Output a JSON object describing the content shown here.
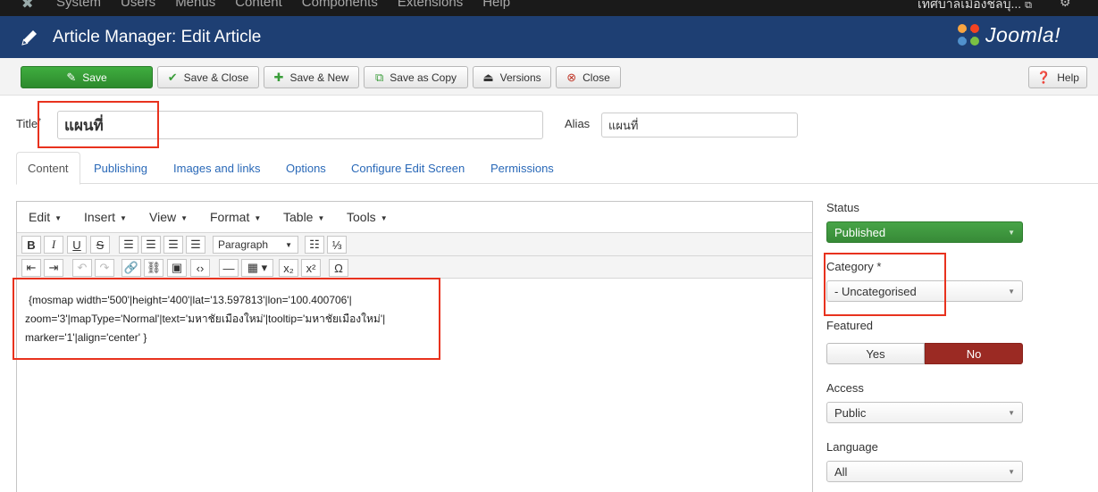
{
  "topnav": {
    "menu": [
      "System",
      "Users",
      "Menus",
      "Content",
      "Components",
      "Extensions",
      "Help"
    ],
    "site_name": "เทศบาลเมืองชลบุ..."
  },
  "header": {
    "title": "Article Manager: Edit Article",
    "logo_text": "Joomla!"
  },
  "toolbar": {
    "save": "Save",
    "save_close": "Save & Close",
    "save_new": "Save & New",
    "save_copy": "Save as Copy",
    "versions": "Versions",
    "close": "Close",
    "help": "Help"
  },
  "form": {
    "title_label": "Title",
    "required_mark": "*",
    "title_value": "แผนที่",
    "alias_label": "Alias",
    "alias_value": "แผนที่"
  },
  "tabs": [
    "Content",
    "Publishing",
    "Images and links",
    "Options",
    "Configure Edit Screen",
    "Permissions"
  ],
  "editor": {
    "menus": [
      "Edit",
      "Insert",
      "View",
      "Format",
      "Table",
      "Tools"
    ],
    "block_format": "Paragraph",
    "content_lines": [
      "{mosmap width='500'|height='400'|lat='13.597813'|lon='100.400706'|",
      "zoom='3'|mapType='Normal'|text='มหาชัยเมืองใหม่'|tooltip='มหาชัยเมืองใหม่'|",
      "marker='1'|align='center' }"
    ]
  },
  "sidebar": {
    "status_label": "Status",
    "status_value": "Published",
    "category_label": "Category *",
    "category_value": "- Uncategorised",
    "featured_label": "Featured",
    "featured_yes": "Yes",
    "featured_no": "No",
    "access_label": "Access",
    "access_value": "Public",
    "language_label": "Language",
    "language_value": "All"
  },
  "colors": {
    "header": "#1e3f73",
    "save_green": "#2d8a2d",
    "published_green": "#47a447",
    "featured_no_red": "#9b2a23",
    "annotation_red": "#e8321e"
  }
}
